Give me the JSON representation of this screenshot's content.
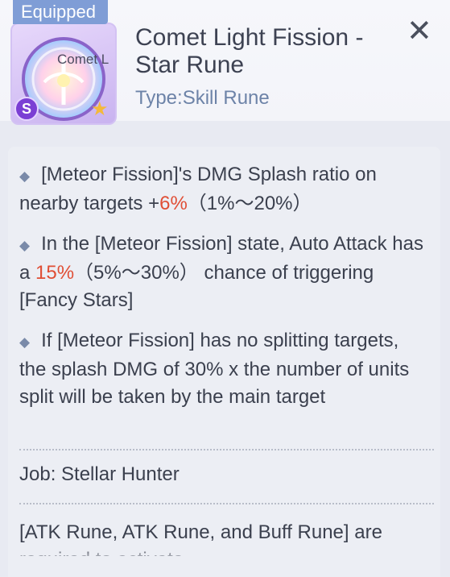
{
  "header": {
    "equipped_label": "Equipped",
    "rune_short_name": "Comet L",
    "title": "Comet Light Fission - Star Rune",
    "type": "Type:Skill Rune",
    "grade": "S",
    "close_icon": "close-icon"
  },
  "description": {
    "p1": {
      "pre": "[Meteor Fission]'s DMG Splash ratio on nearby targets +",
      "value": "6%",
      "post": "（1%～20%）"
    },
    "p2": {
      "pre": "In the [Meteor Fission] state, Auto Attack has a ",
      "value": "15%",
      "post": "（5%～30%） chance of triggering [Fancy Stars]"
    },
    "p3": "If [Meteor Fission] has no splitting targets, the splash DMG of 30% x the number of units split will be taken by the main target",
    "job": "Job: Stellar Hunter",
    "requirement": "[ATK Rune, ATK Rune, and Buff Rune] are required to activate"
  },
  "colors": {
    "accent_value": "#e04e35",
    "badge": "#7f9dd6",
    "type_text": "#6d83a8"
  }
}
